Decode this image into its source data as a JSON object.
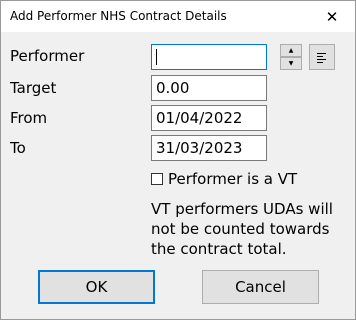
{
  "window": {
    "title": "Add Performer NHS Contract Details",
    "close_glyph": "✕"
  },
  "form": {
    "performer_label": "Performer",
    "performer_value": "",
    "target_label": "Target",
    "target_value": "0.00",
    "from_label": "From",
    "from_value": "01/04/2022",
    "to_label": "To",
    "to_value": "31/03/2023"
  },
  "spinner": {
    "up_glyph": "▲",
    "down_glyph": "▼"
  },
  "vt": {
    "checkbox_label": "Performer is a VT",
    "checked": false,
    "note": "VT performers UDAs will not be counted towards the contract total."
  },
  "buttons": {
    "ok_label": "OK",
    "cancel_label": "Cancel"
  },
  "colors": {
    "accent": "#0078d7",
    "background": "#f0f0f0",
    "button": "#e1e1e1"
  }
}
